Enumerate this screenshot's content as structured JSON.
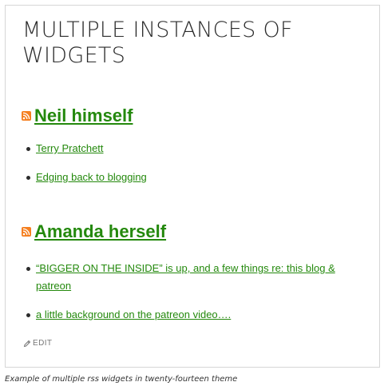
{
  "page": {
    "title": "MULTIPLE INSTANCES OF WIDGETS",
    "edit_label": "EDIT",
    "caption": "Example of multiple rss widgets in twenty-fourteen theme"
  },
  "widgets": [
    {
      "title": "Neil himself",
      "icon": "rss-icon",
      "items": [
        "Terry Pratchett",
        "Edging back to blogging"
      ]
    },
    {
      "title": "Amanda herself",
      "icon": "rss-icon",
      "items": [
        "“BIGGER ON THE INSIDE” is up, and a few things re: this blog & patreon",
        "a little background on the patreon video…."
      ]
    }
  ],
  "colors": {
    "link": "#24890d",
    "rss": "#f57f20",
    "text": "#2b2b2b",
    "border": "#d6d6d6"
  }
}
